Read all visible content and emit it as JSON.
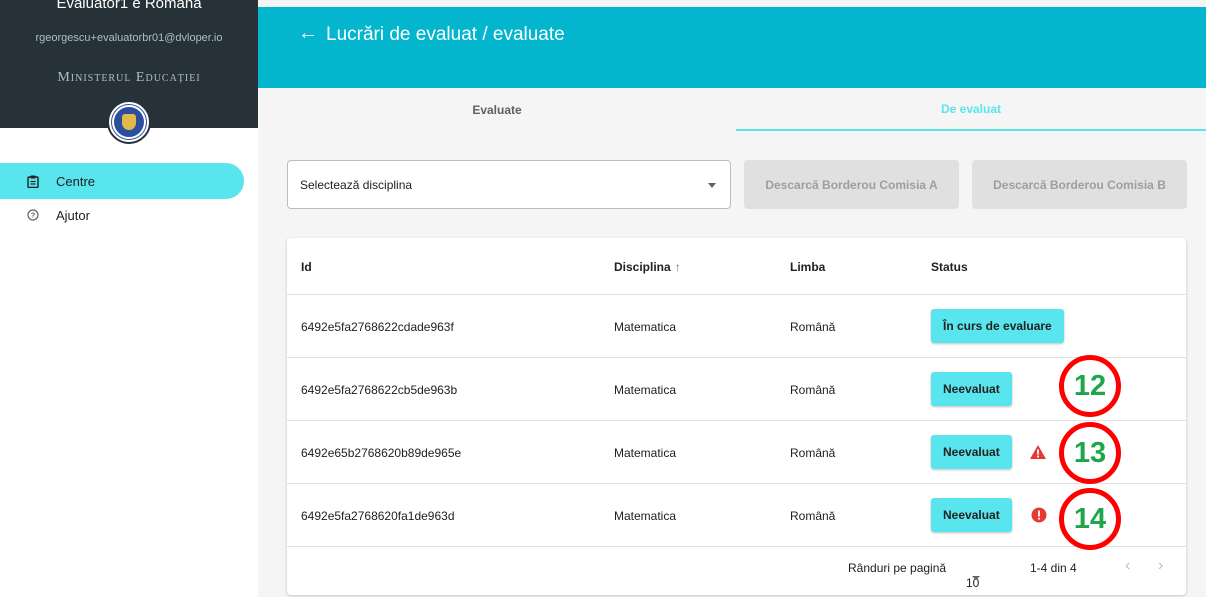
{
  "sidebar": {
    "user_name": "Evaluator1 e Romana",
    "user_email": "rgeorgescu+evaluatorbr01@dvloper.io",
    "ministry": "Ministerul Educației",
    "logo_icon": "guvernul-romaniei-logo",
    "items": [
      {
        "label": "Centre",
        "icon": "clipboard-icon",
        "active": true
      },
      {
        "label": "Ajutor",
        "icon": "help-circle-icon",
        "active": false
      }
    ]
  },
  "header": {
    "back_icon": "←",
    "title": "Lucrări de evaluat / evaluate"
  },
  "tabs": [
    {
      "label": "Evaluate",
      "active": false
    },
    {
      "label": "De evaluat",
      "active": true
    }
  ],
  "filters": {
    "discipline_select": "Selectează disciplina",
    "btn_commission_a": "Descarcă Borderou Comisia A",
    "btn_commission_b": "Descarcă Borderou Comisia B"
  },
  "table": {
    "columns": {
      "id": "Id",
      "discipline": "Disciplina",
      "sort_icon": "↑",
      "language": "Limba",
      "status": "Status"
    },
    "rows": [
      {
        "id": "6492e5fa2768622cdade963f",
        "discipline": "Matematica",
        "language": "Română",
        "status": "În curs de evaluare",
        "flag": ""
      },
      {
        "id": "6492e5fa2768622cb5de963b",
        "discipline": "Matematica",
        "language": "Română",
        "status": "Neevaluat",
        "flag": ""
      },
      {
        "id": "6492e65b2768620b89de965e",
        "discipline": "Matematica",
        "language": "Română",
        "status": "Neevaluat",
        "flag": "warning-triangle-icon"
      },
      {
        "id": "6492e5fa2768620fa1de963d",
        "discipline": "Matematica",
        "language": "Română",
        "status": "Neevaluat",
        "flag": "info-circle-icon"
      }
    ]
  },
  "pagination": {
    "rows_per_page_label": "Rânduri pe pagină",
    "rows_per_page": "10",
    "range": "1-4 din 4",
    "prev": "‹",
    "next": "›"
  },
  "annotations": [
    "12",
    "13",
    "14"
  ],
  "colors": {
    "accent": "#04b5ce",
    "highlight": "#59e5ed",
    "sidebar_dark": "#263238",
    "annotation_ring": "#ff0000",
    "annotation_text": "#1fa64b",
    "warning": "#e53935"
  }
}
